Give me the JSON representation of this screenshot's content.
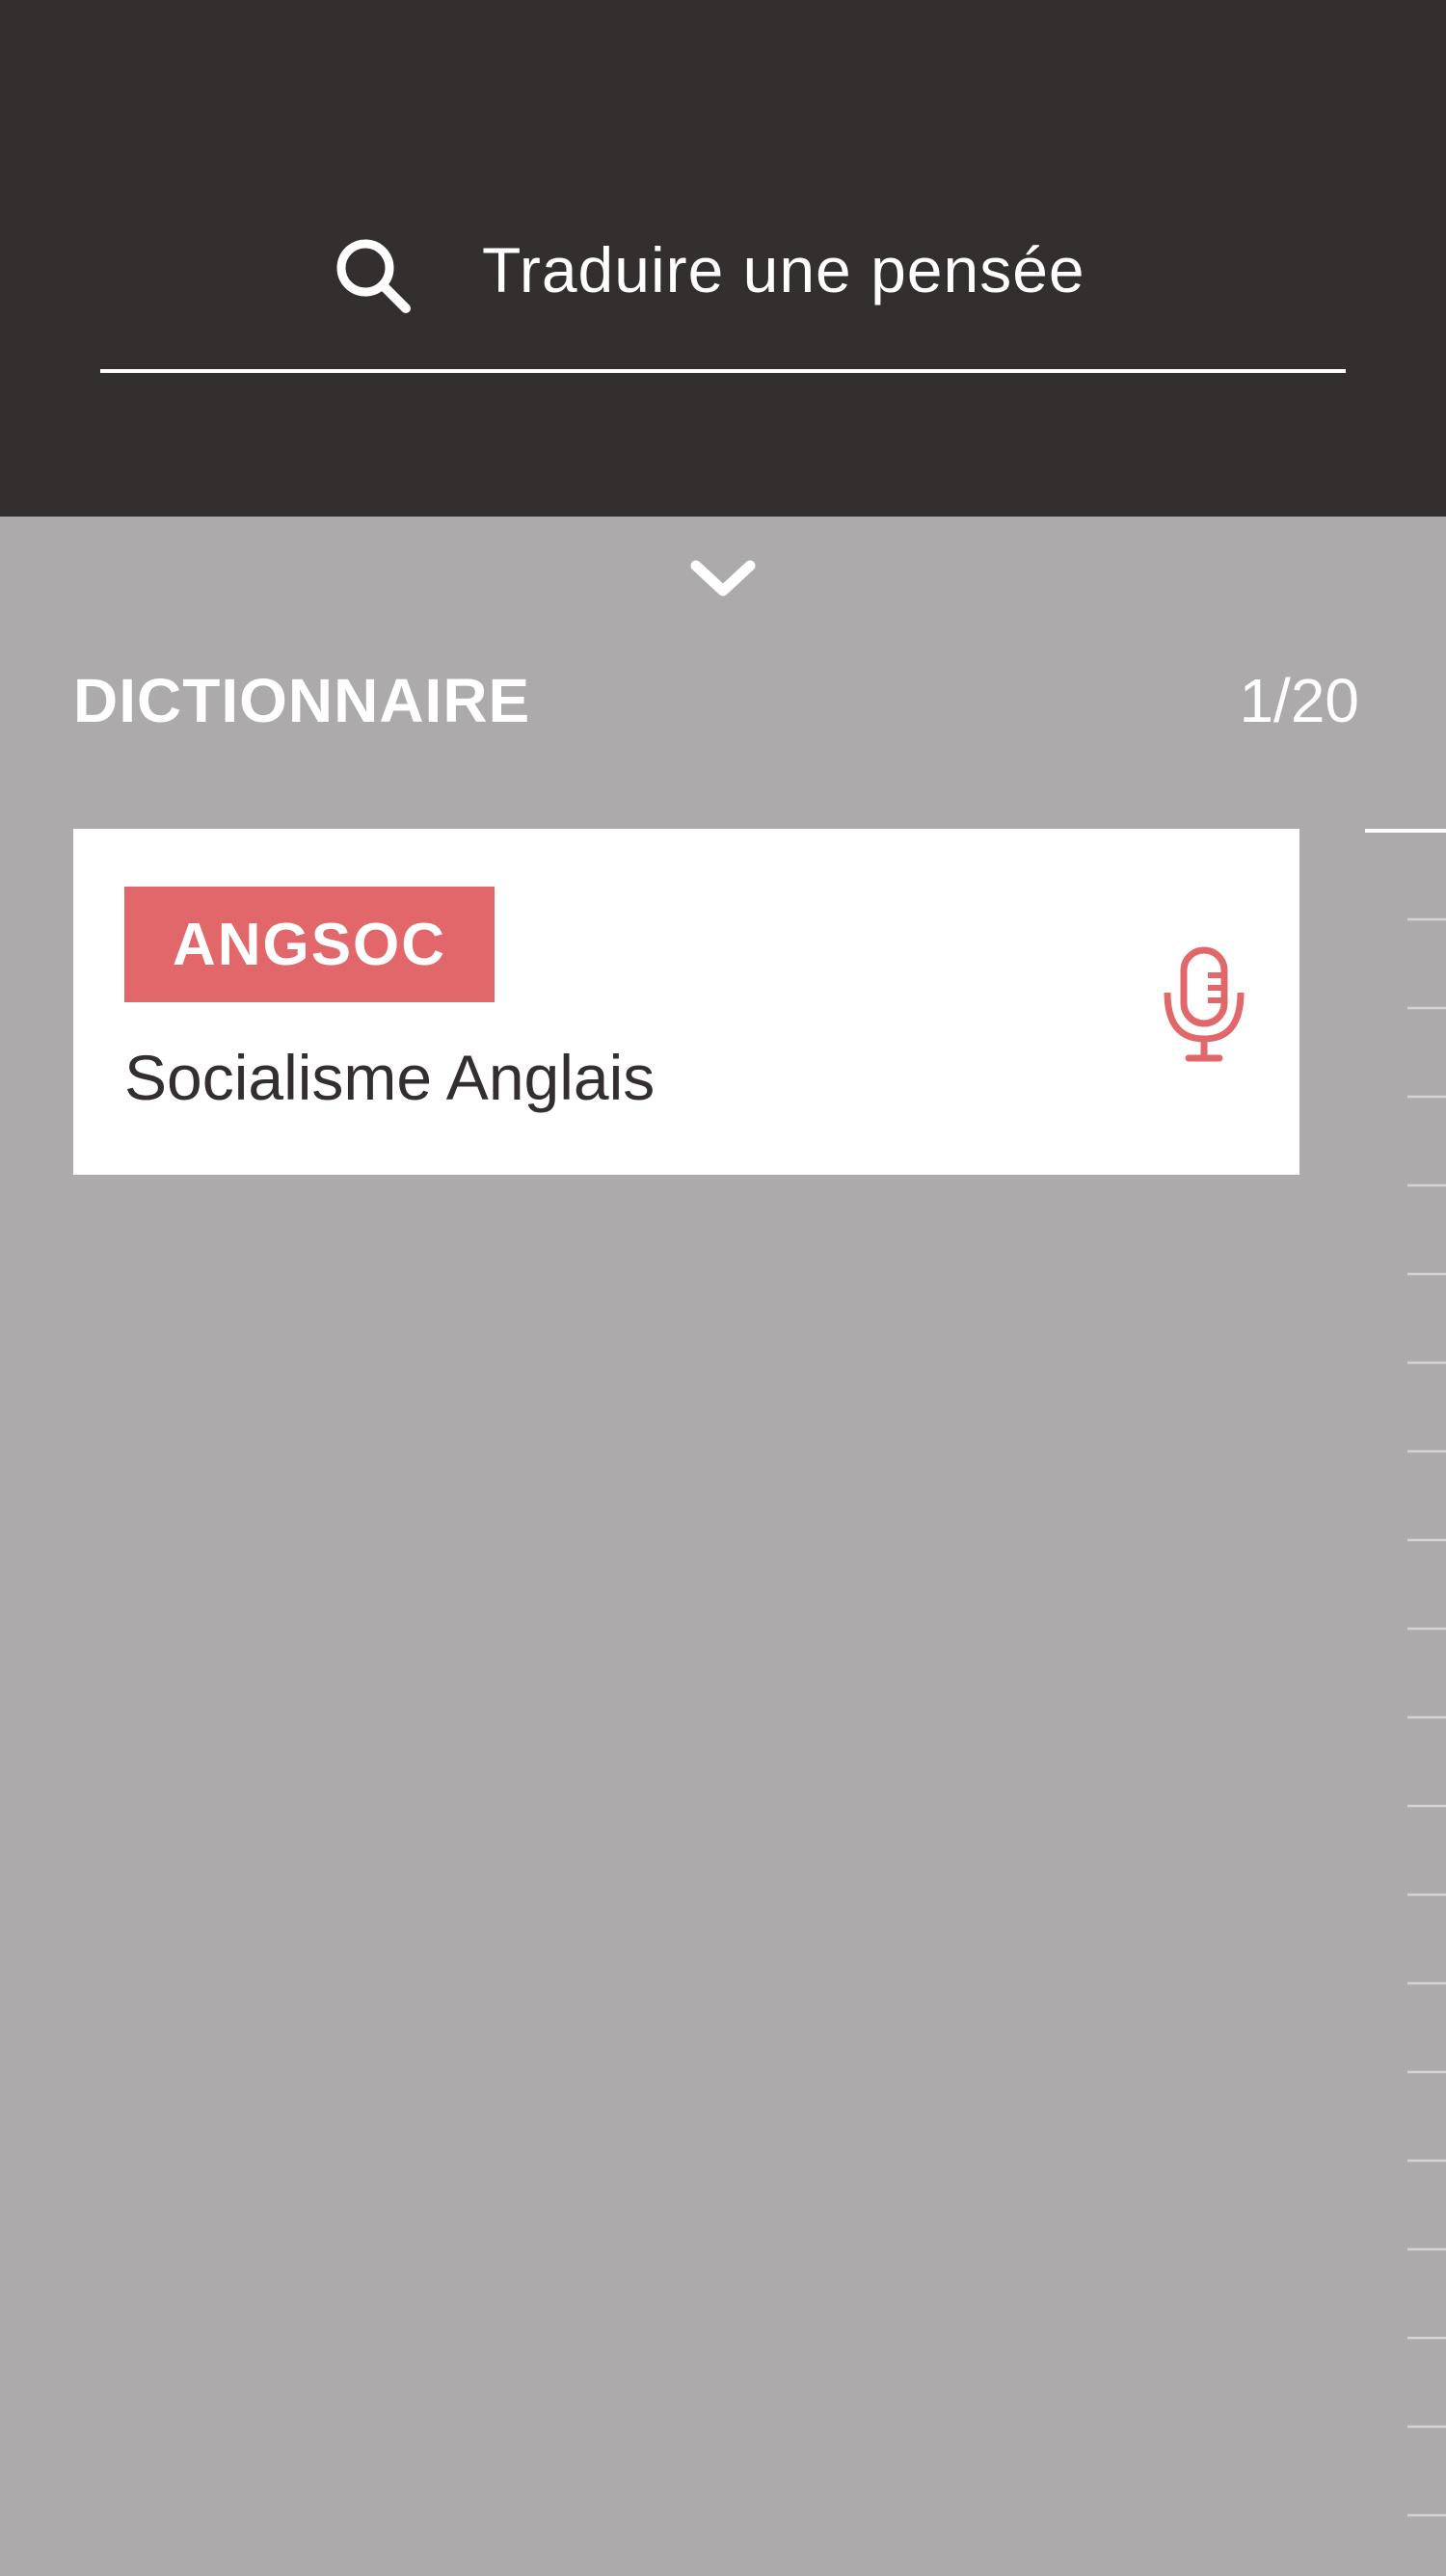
{
  "search": {
    "placeholder": "Traduire une pensée"
  },
  "section": {
    "title": "DICTIONNAIRE",
    "count": "1/20"
  },
  "entries": [
    {
      "tag": "ANGSOC",
      "definition": "Socialisme Anglais"
    }
  ],
  "colors": {
    "header_bg": "#332f2f",
    "page_bg": "#acaaab",
    "accent": "#e2676b",
    "card_bg": "#ffffff",
    "text_dark": "#332f2f"
  },
  "icons": {
    "search": "search-icon",
    "expand": "chevron-down-icon",
    "audio": "microphone-icon"
  }
}
